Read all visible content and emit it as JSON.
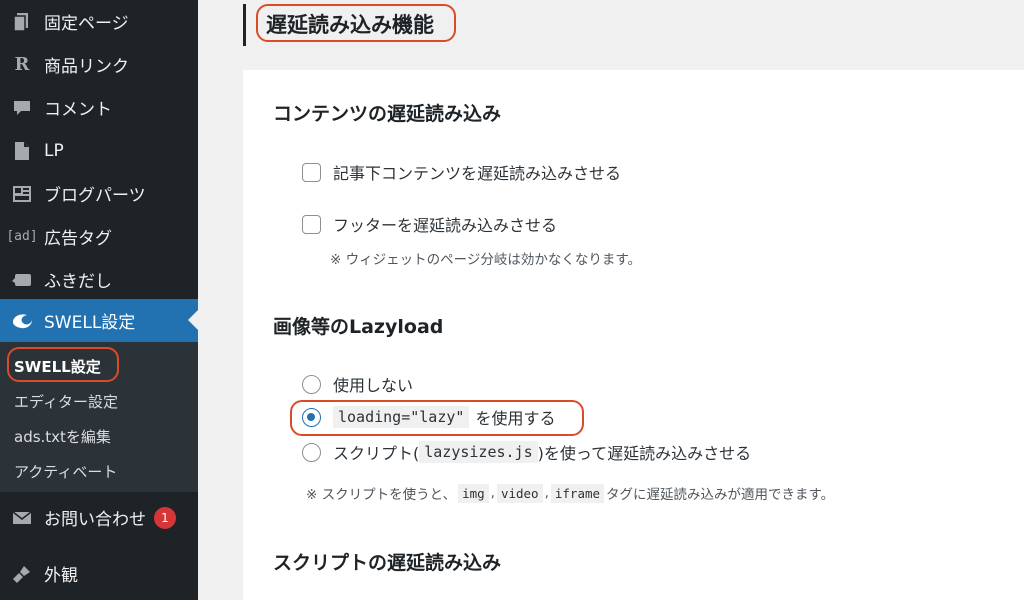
{
  "sidebar": {
    "items": [
      {
        "label": "固定ページ",
        "icon": "page-icon"
      },
      {
        "label": "商品リンク",
        "icon": "r-icon"
      },
      {
        "label": "コメント",
        "icon": "comment-icon"
      },
      {
        "label": "LP",
        "icon": "document-icon"
      },
      {
        "label": "ブログパーツ",
        "icon": "layout-icon"
      },
      {
        "label": "広告タグ",
        "icon": "ad-icon",
        "icon_text": "[ad]"
      },
      {
        "label": "ふきだし",
        "icon": "speech-bubble-icon"
      },
      {
        "label": "SWELL設定",
        "icon": "swell-icon",
        "active": true
      },
      {
        "label": "お問い合わせ",
        "icon": "mail-icon",
        "badge": "1"
      },
      {
        "label": "外観",
        "icon": "brush-icon"
      }
    ],
    "submenu": [
      {
        "label": "SWELL設定",
        "current": true
      },
      {
        "label": "エディター設定"
      },
      {
        "label": "ads.txtを編集"
      },
      {
        "label": "アクティベート"
      }
    ]
  },
  "main": {
    "heading": "遅延読み込み機能",
    "sections": {
      "content_lazy": {
        "title": "コンテンツの遅延読み込み",
        "options": [
          "記事下コンテンツを遅延読み込みさせる",
          "フッターを遅延読み込みさせる"
        ],
        "note": "※ ウィジェットのページ分岐は効かなくなります。"
      },
      "image_lazy": {
        "title": "画像等のLazyload",
        "option_none": "使用しない",
        "option_native_code": "loading=\"lazy\"",
        "option_native_suffix": "を使用する",
        "option_script_prefix": "スクリプト(",
        "option_script_code": "lazysizes.js",
        "option_script_suffix": ")を使って遅延読み込みさせる",
        "selected": "loading=\"lazy\"",
        "note_prefix": "※ スクリプトを使うと、",
        "note_code1": "img",
        "note_sep1": ",",
        "note_code2": "video",
        "note_sep2": ",",
        "note_code3": "iframe",
        "note_suffix": "タグに遅延読み込みが適用できます。"
      },
      "script_lazy": {
        "title": "スクリプトの遅延読み込み"
      }
    }
  },
  "colors": {
    "sidebar_bg": "#1d2327",
    "active_bg": "#2271b1",
    "highlight": "#d94c2a",
    "badge": "#d63638"
  }
}
